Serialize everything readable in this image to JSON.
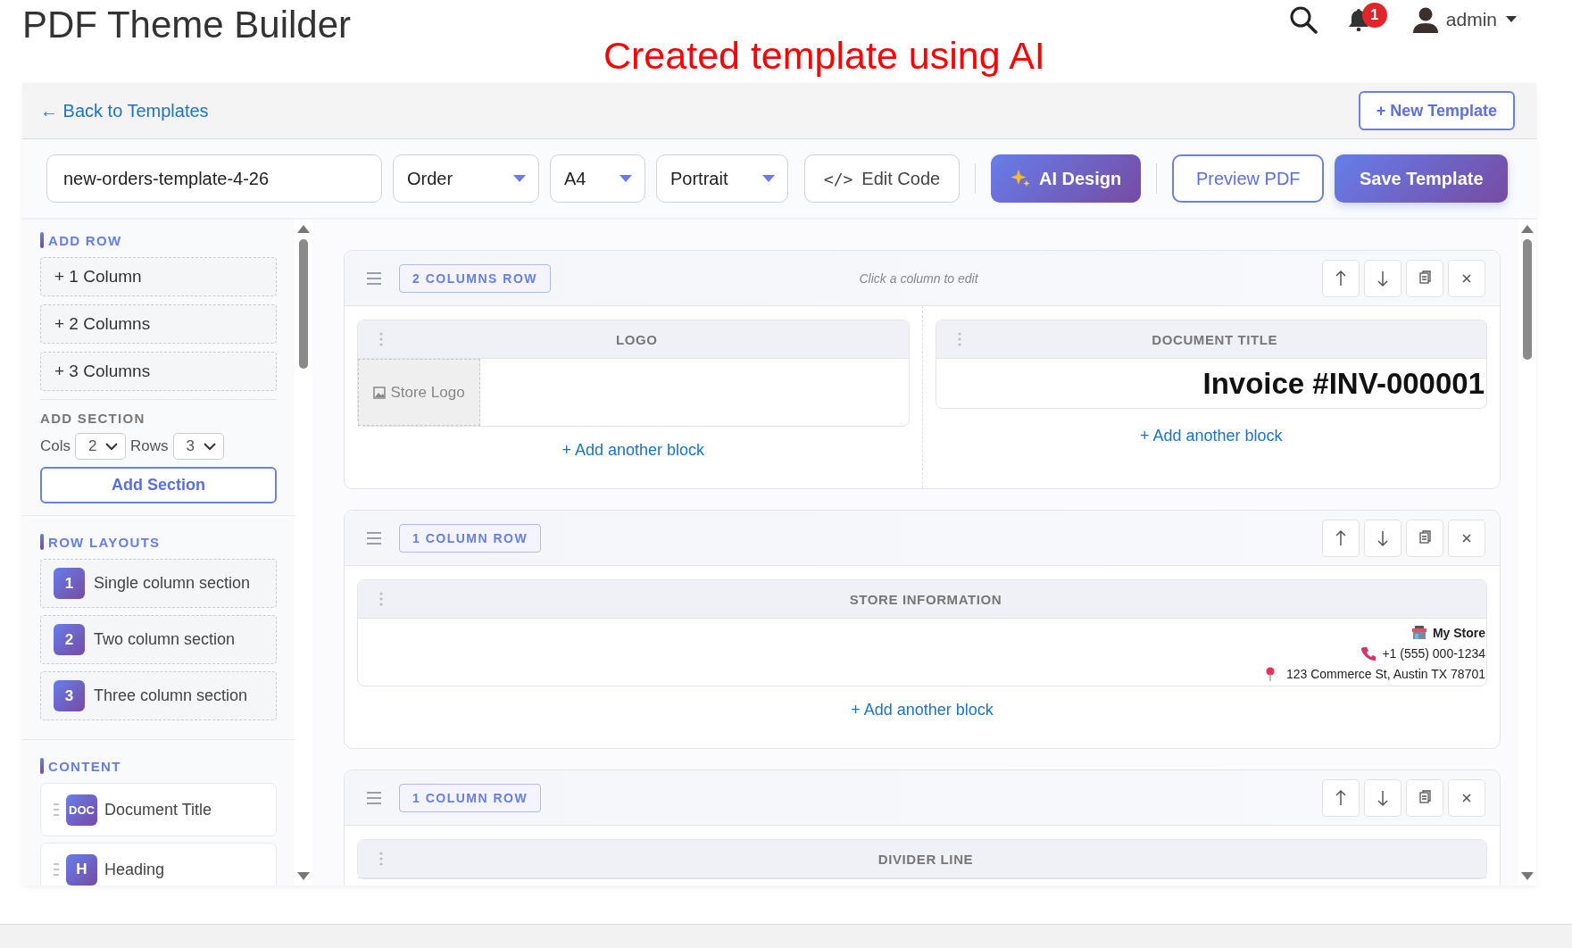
{
  "app": {
    "title": "PDF Theme Builder",
    "annotation": "Created template using AI",
    "notifications": "1",
    "user": "admin"
  },
  "nav": {
    "back_link": "← Back to Templates",
    "new_template": "+ New Template"
  },
  "toolbar": {
    "template_name": "new-orders-template-4-26",
    "type": "Order",
    "size": "A4",
    "orientation": "Portrait",
    "buttons": [
      {
        "kind": "code",
        "icon": "</>",
        "label": "Edit Code"
      },
      {
        "kind": "ai",
        "label": "AI Design"
      },
      {
        "kind": "outline",
        "label": "Preview PDF"
      },
      {
        "kind": "primary",
        "label": "Save Template"
      }
    ]
  },
  "sidebar": {
    "add_row": {
      "heading": "ADD ROW",
      "items": [
        "+ 1 Column",
        "+ 2 Columns",
        "+ 3 Columns"
      ]
    },
    "add_section": {
      "heading": "ADD SECTION",
      "cols_label": "Cols",
      "cols": "2",
      "rows_label": "Rows",
      "rows": "3",
      "button": "Add Section"
    },
    "row_layouts": {
      "heading": "ROW LAYOUTS",
      "items": [
        {
          "badge": "1",
          "label": "Single column section"
        },
        {
          "badge": "2",
          "label": "Two column section"
        },
        {
          "badge": "3",
          "label": "Three column section"
        }
      ]
    },
    "content": {
      "heading": "CONTENT",
      "items": [
        {
          "badge": "DOC",
          "label": "Document Title"
        },
        {
          "badge": "H",
          "label": "Heading"
        }
      ]
    }
  },
  "canvas": {
    "rows": [
      {
        "tag": "2 COLUMNS ROW",
        "hint": "Click a column to edit",
        "columns": [
          {
            "blocks": [
              {
                "kind": "logo",
                "title": "LOGO",
                "text": "Store Logo"
              }
            ],
            "add_link": "+ Add another block"
          },
          {
            "blocks": [
              {
                "kind": "title",
                "title": "DOCUMENT TITLE",
                "text": "Invoice #INV-000001"
              }
            ],
            "add_link": "+ Add another block"
          }
        ]
      },
      {
        "tag": "1 COLUMN ROW",
        "columns": [
          {
            "blocks": [
              {
                "kind": "store",
                "title": "STORE INFORMATION",
                "lines": [
                  {
                    "kind": "name",
                    "text": "My Store"
                  },
                  {
                    "kind": "phone",
                    "text": "+1 (555) 000-1234"
                  },
                  {
                    "kind": "address",
                    "text": "123 Commerce St, Austin TX 78701"
                  }
                ]
              }
            ],
            "add_link": "+ Add another block"
          }
        ]
      },
      {
        "tag": "1 COLUMN ROW",
        "columns": [
          {
            "blocks": [
              {
                "kind": "divider",
                "title": "DIVIDER LINE"
              }
            ]
          }
        ]
      }
    ]
  }
}
